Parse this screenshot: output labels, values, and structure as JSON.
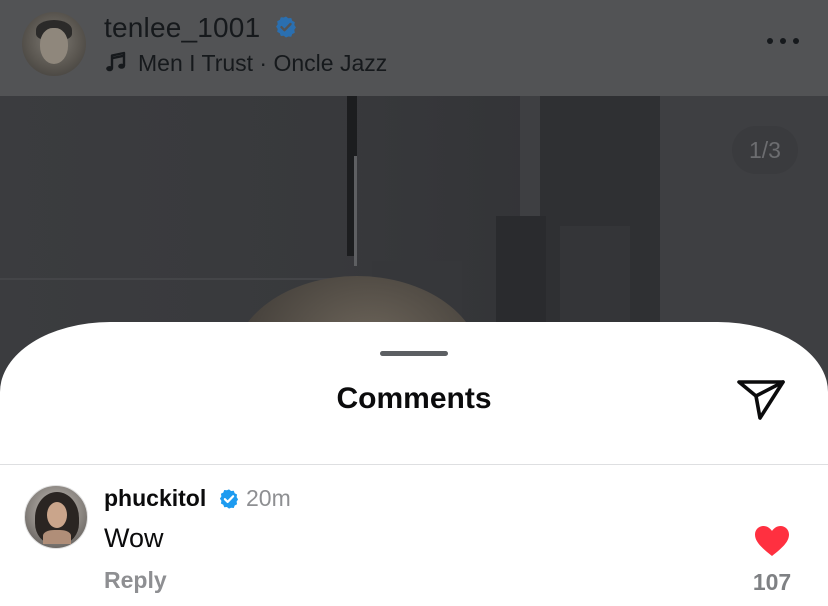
{
  "post_header": {
    "username": "tenlee_1001",
    "verified_icon": "verified-badge-icon",
    "music_icon": "music-note-icon",
    "song": "Men I Trust · Oncle Jazz",
    "more_icon": "more-horizontal-icon"
  },
  "photo": {
    "counter": "1/3"
  },
  "comments_sheet": {
    "title": "Comments",
    "share_icon": "send-icon",
    "comments": [
      {
        "username": "phuckitol",
        "verified": true,
        "time": "20m",
        "text": "Wow",
        "reply_label": "Reply",
        "liked": true,
        "like_count": "107"
      }
    ]
  },
  "colors": {
    "verified_blue": "#1d9bf0",
    "like_red": "#ff3040",
    "dim_overlay": "#525355"
  }
}
